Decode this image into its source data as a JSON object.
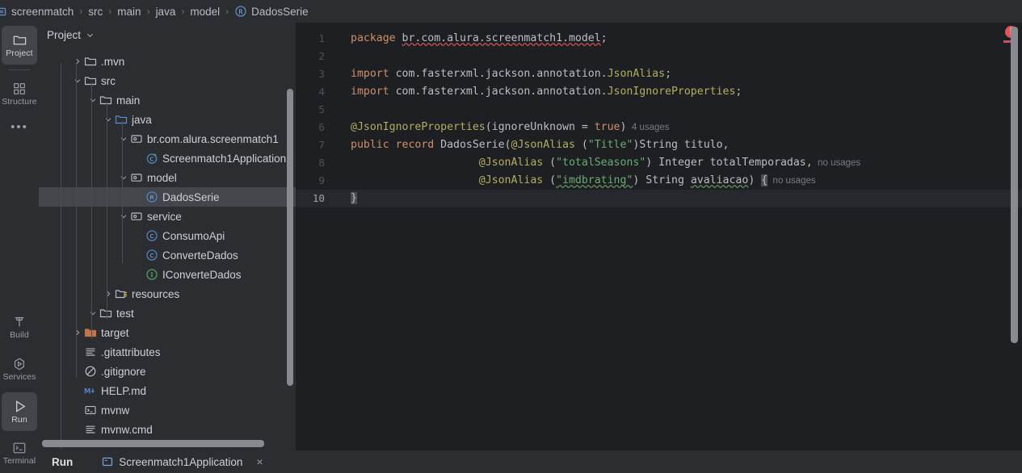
{
  "window": {
    "theme_bg": "#1e1f22",
    "panel_bg": "#2b2d30",
    "accent_blue": "#3574f0",
    "error_red": "#e05561"
  },
  "breadcrumb": {
    "separator": "›",
    "items": [
      {
        "label": "screenmatch",
        "icon": "module-icon"
      },
      {
        "label": "src",
        "icon": ""
      },
      {
        "label": "main",
        "icon": ""
      },
      {
        "label": "java",
        "icon": ""
      },
      {
        "label": "model",
        "icon": ""
      },
      {
        "label": "DadosSerie",
        "icon": "record-icon"
      }
    ]
  },
  "activity_bar": {
    "top_items": [
      {
        "label": "Project",
        "icon": "folder-icon",
        "selected": true
      },
      {
        "label": "Structure",
        "icon": "structure-icon",
        "selected": false
      }
    ],
    "more_label": "•••",
    "bottom_items": [
      {
        "label": "Build",
        "icon": "hammer-icon",
        "selected": false
      },
      {
        "label": "Services",
        "icon": "services-icon",
        "selected": false
      },
      {
        "label": "Run",
        "icon": "run-icon",
        "selected": true
      },
      {
        "label": "Terminal",
        "icon": "terminal-icon",
        "selected": false
      }
    ]
  },
  "project_panel": {
    "title": "Project",
    "dropdown_icon": "chevron-down-icon",
    "tree": [
      {
        "label": ".mvn",
        "indent": 1,
        "arrow": "collapsed",
        "icon": "folder-icon",
        "selected": false
      },
      {
        "label": "src",
        "indent": 1,
        "arrow": "expanded",
        "icon": "folder-icon",
        "selected": false
      },
      {
        "label": "main",
        "indent": 2,
        "arrow": "expanded",
        "icon": "folder-icon",
        "selected": false
      },
      {
        "label": "java",
        "indent": 3,
        "arrow": "expanded",
        "icon": "source-folder-icon",
        "selected": false
      },
      {
        "label": "br.com.alura.screenmatch1",
        "indent": 4,
        "arrow": "expanded",
        "icon": "package-icon",
        "selected": false
      },
      {
        "label": "Screenmatch1Application",
        "indent": 5,
        "arrow": "none",
        "icon": "spring-class-icon",
        "selected": false
      },
      {
        "label": "model",
        "indent": 4,
        "arrow": "expanded",
        "icon": "package-icon",
        "selected": false
      },
      {
        "label": "DadosSerie",
        "indent": 5,
        "arrow": "none",
        "icon": "record-icon",
        "selected": true
      },
      {
        "label": "service",
        "indent": 4,
        "arrow": "expanded",
        "icon": "package-icon",
        "selected": false
      },
      {
        "label": "ConsumoApi",
        "indent": 5,
        "arrow": "none",
        "icon": "class-icon",
        "selected": false
      },
      {
        "label": "ConverteDados",
        "indent": 5,
        "arrow": "none",
        "icon": "class-icon",
        "selected": false
      },
      {
        "label": "IConverteDados",
        "indent": 5,
        "arrow": "none",
        "icon": "interface-icon",
        "selected": false
      },
      {
        "label": "resources",
        "indent": 3,
        "arrow": "collapsed",
        "icon": "resource-folder-icon",
        "selected": false
      },
      {
        "label": "test",
        "indent": 2,
        "arrow": "expanded",
        "icon": "folder-icon",
        "selected": false
      },
      {
        "label": "target",
        "indent": 1,
        "arrow": "collapsed",
        "icon": "target-folder-icon",
        "selected": false
      },
      {
        "label": ".gitattributes",
        "indent": 1,
        "arrow": "none",
        "icon": "text-file-icon",
        "selected": false
      },
      {
        "label": ".gitignore",
        "indent": 1,
        "arrow": "none",
        "icon": "ignore-file-icon",
        "selected": false
      },
      {
        "label": "HELP.md",
        "indent": 1,
        "arrow": "none",
        "icon": "markdown-file-icon",
        "selected": false
      },
      {
        "label": "mvnw",
        "indent": 1,
        "arrow": "none",
        "icon": "shell-file-icon",
        "selected": false
      },
      {
        "label": "mvnw.cmd",
        "indent": 1,
        "arrow": "none",
        "icon": "text-file-icon",
        "selected": false
      }
    ]
  },
  "editor": {
    "error_badge": "!",
    "lines": [
      {
        "number": "1",
        "caret": false,
        "tokens": [
          {
            "t": "package ",
            "c": "tok-kw"
          },
          {
            "t": "br.com.alura.screenmatch1.model",
            "c": "tok-plain squiggle-red"
          },
          {
            "t": ";",
            "c": "tok-plain"
          }
        ]
      },
      {
        "number": "2",
        "caret": false,
        "tokens": []
      },
      {
        "number": "3",
        "caret": false,
        "tokens": [
          {
            "t": "import ",
            "c": "tok-kw"
          },
          {
            "t": "com.fasterxml.jackson.annotation.",
            "c": "tok-plain"
          },
          {
            "t": "JsonAlias",
            "c": "tok-ann"
          },
          {
            "t": ";",
            "c": "tok-plain"
          }
        ]
      },
      {
        "number": "4",
        "caret": false,
        "tokens": [
          {
            "t": "import ",
            "c": "tok-kw"
          },
          {
            "t": "com.fasterxml.jackson.annotation.",
            "c": "tok-plain"
          },
          {
            "t": "JsonIgnoreProperties",
            "c": "tok-ann"
          },
          {
            "t": ";",
            "c": "tok-plain"
          }
        ]
      },
      {
        "number": "5",
        "caret": false,
        "tokens": []
      },
      {
        "number": "6",
        "caret": false,
        "tokens": [
          {
            "t": "@JsonIgnoreProperties",
            "c": "tok-ann"
          },
          {
            "t": "(ignoreUnknown = ",
            "c": "tok-plain"
          },
          {
            "t": "true",
            "c": "tok-kw"
          },
          {
            "t": ")",
            "c": "tok-plain"
          },
          {
            "t": "  4 usages",
            "c": "tok-hint"
          }
        ]
      },
      {
        "number": "7",
        "caret": false,
        "tokens": [
          {
            "t": "public record ",
            "c": "tok-kw"
          },
          {
            "t": "DadosSerie(",
            "c": "tok-plain"
          },
          {
            "t": "@JsonAlias ",
            "c": "tok-ann"
          },
          {
            "t": "(",
            "c": "tok-plain"
          },
          {
            "t": "\"Title\"",
            "c": "tok-str"
          },
          {
            "t": ")String titulo,",
            "c": "tok-plain"
          }
        ]
      },
      {
        "number": "8",
        "caret": false,
        "tokens": [
          {
            "t": "                    ",
            "c": "tok-plain"
          },
          {
            "t": "@JsonAlias ",
            "c": "tok-ann"
          },
          {
            "t": "(",
            "c": "tok-plain"
          },
          {
            "t": "\"totalSeasons\"",
            "c": "tok-str"
          },
          {
            "t": ") Integer totalTemporadas,",
            "c": "tok-plain"
          },
          {
            "t": "  no usages",
            "c": "tok-hint"
          }
        ]
      },
      {
        "number": "9",
        "caret": false,
        "tokens": [
          {
            "t": "                    ",
            "c": "tok-plain"
          },
          {
            "t": "@JsonAlias ",
            "c": "tok-ann"
          },
          {
            "t": "(",
            "c": "tok-plain"
          },
          {
            "t": "\"imdbrating\"",
            "c": "tok-str squiggle-green"
          },
          {
            "t": ") String ",
            "c": "tok-plain"
          },
          {
            "t": "avaliacao",
            "c": "tok-plain squiggle-green"
          },
          {
            "t": ") ",
            "c": "tok-plain"
          },
          {
            "t": "{",
            "c": "tok-plain caret-block"
          },
          {
            "t": "  no usages",
            "c": "tok-hint"
          }
        ]
      },
      {
        "number": "10",
        "caret": true,
        "tokens": [
          {
            "t": "}",
            "c": "tok-plain caret-block"
          }
        ]
      }
    ]
  },
  "run_panel": {
    "title": "Run",
    "tab_label": "Screenmatch1Application",
    "tab_icon": "console-icon",
    "close_icon": "close-icon",
    "close_glyph": "×"
  }
}
